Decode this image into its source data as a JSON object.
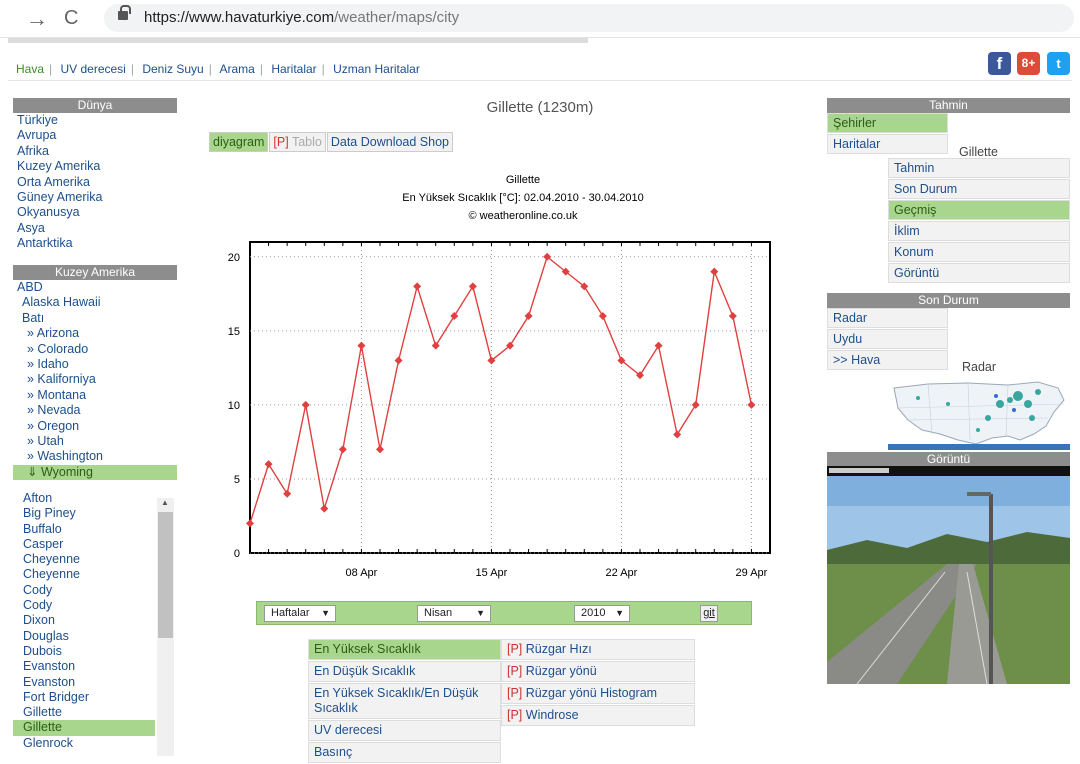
{
  "browser": {
    "url_domain": "https://www.havaturkiye.com",
    "url_path": "/weather/maps/city"
  },
  "topnav": [
    "Hava",
    "UV derecesi",
    "Deniz Suyu",
    "Arama",
    "Haritalar",
    "Uzman Haritalar"
  ],
  "social": {
    "facebook": "f",
    "googleplus": "8+",
    "twitter": "t"
  },
  "world": {
    "title": "Dünya",
    "items": [
      "Türkiye",
      "Avrupa",
      "Afrika",
      "Kuzey Amerika",
      "Orta Amerika",
      "Güney Amerika",
      "Okyanusya",
      "Asya",
      "Antarktika"
    ]
  },
  "na": {
    "title": "Kuzey Amerika",
    "country": "ABD",
    "regions": [
      "Alaska Hawaii",
      "Batı"
    ],
    "states": [
      "» Arizona",
      "» Colorado",
      "» Idaho",
      "» Kaliforniya",
      "» Montana",
      "» Nevada",
      "» Oregon",
      "» Utah",
      "» Washington"
    ],
    "selected_state": "⇓ Wyoming"
  },
  "cities": [
    "Afton",
    "Big Piney",
    "Buffalo",
    "Casper",
    "Cheyenne",
    "Cheyenne",
    "Cody",
    "Cody",
    "Dixon",
    "Douglas",
    "Dubois",
    "Evanston",
    "Evanston",
    "Fort Bridger",
    "Gillette",
    "Gillette",
    "Glenrock"
  ],
  "selected_city_index": 15,
  "main": {
    "title": "Gillette (1230m)",
    "tabs": {
      "diagram": "diyagram",
      "p": "[P]",
      "table": "Tablo",
      "shop": "Data Download Shop"
    }
  },
  "chart_data": {
    "type": "line",
    "title": "Gillette",
    "subtitle": "En Yüksek Sıcaklık [°C]: 02.04.2010 - 30.04.2010",
    "credit": "© weatheronline.co.uk",
    "x_tick_labels": [
      "08 Apr",
      "15 Apr",
      "22 Apr",
      "29 Apr"
    ],
    "x_ticks": [
      8,
      15,
      22,
      29
    ],
    "xlim": [
      2,
      30
    ],
    "ylim": [
      0,
      21
    ],
    "y_ticks": [
      0,
      5,
      10,
      15,
      20
    ],
    "grid": true,
    "color": "#e04040",
    "x": [
      2,
      3,
      4,
      5,
      6,
      7,
      8,
      9,
      10,
      11,
      12,
      13,
      14,
      15,
      16,
      17,
      18,
      19,
      20,
      21,
      22,
      23,
      24,
      25,
      26,
      27,
      28,
      29,
      30
    ],
    "values": [
      2,
      6,
      4,
      10,
      3,
      7,
      14,
      7,
      13,
      18,
      14,
      16,
      18,
      13,
      14,
      16,
      20,
      19,
      18,
      16,
      13,
      12,
      14,
      8,
      10,
      19,
      16,
      10,
      null
    ]
  },
  "selectors": {
    "period": "Haftalar",
    "month": "Nisan",
    "year": "2010",
    "go": "git"
  },
  "params_left": [
    "En Yüksek Sıcaklık",
    "En Düşük Sıcaklık",
    "En Yüksek Sıcaklık/En Düşük Sıcaklık",
    "UV derecesi",
    "Basınç"
  ],
  "params_right": [
    "Rüzgar Hızı",
    "Rüzgar yönü",
    "Rüzgar yönü Histogram",
    "Windrose"
  ],
  "params_right_prefix": "[P]",
  "forecast": {
    "title": "Tahmin",
    "tabs": [
      "Şehirler",
      "Haritalar"
    ]
  },
  "city_menu": {
    "title": "Gillette",
    "items": [
      "Tahmin",
      "Son Durum",
      "Geçmiş",
      "İklim",
      "Konum",
      "Görüntü"
    ],
    "selected": 2
  },
  "current": {
    "title": "Son Durum",
    "items": [
      "Radar",
      "Uydu",
      ">> Hava"
    ]
  },
  "radar_title": "Radar",
  "camera_title": "Görüntü",
  "colors": {
    "green": "#a8d68c",
    "link": "#1d4f8c",
    "header": "#8d8d8d",
    "line": "#e04040"
  }
}
